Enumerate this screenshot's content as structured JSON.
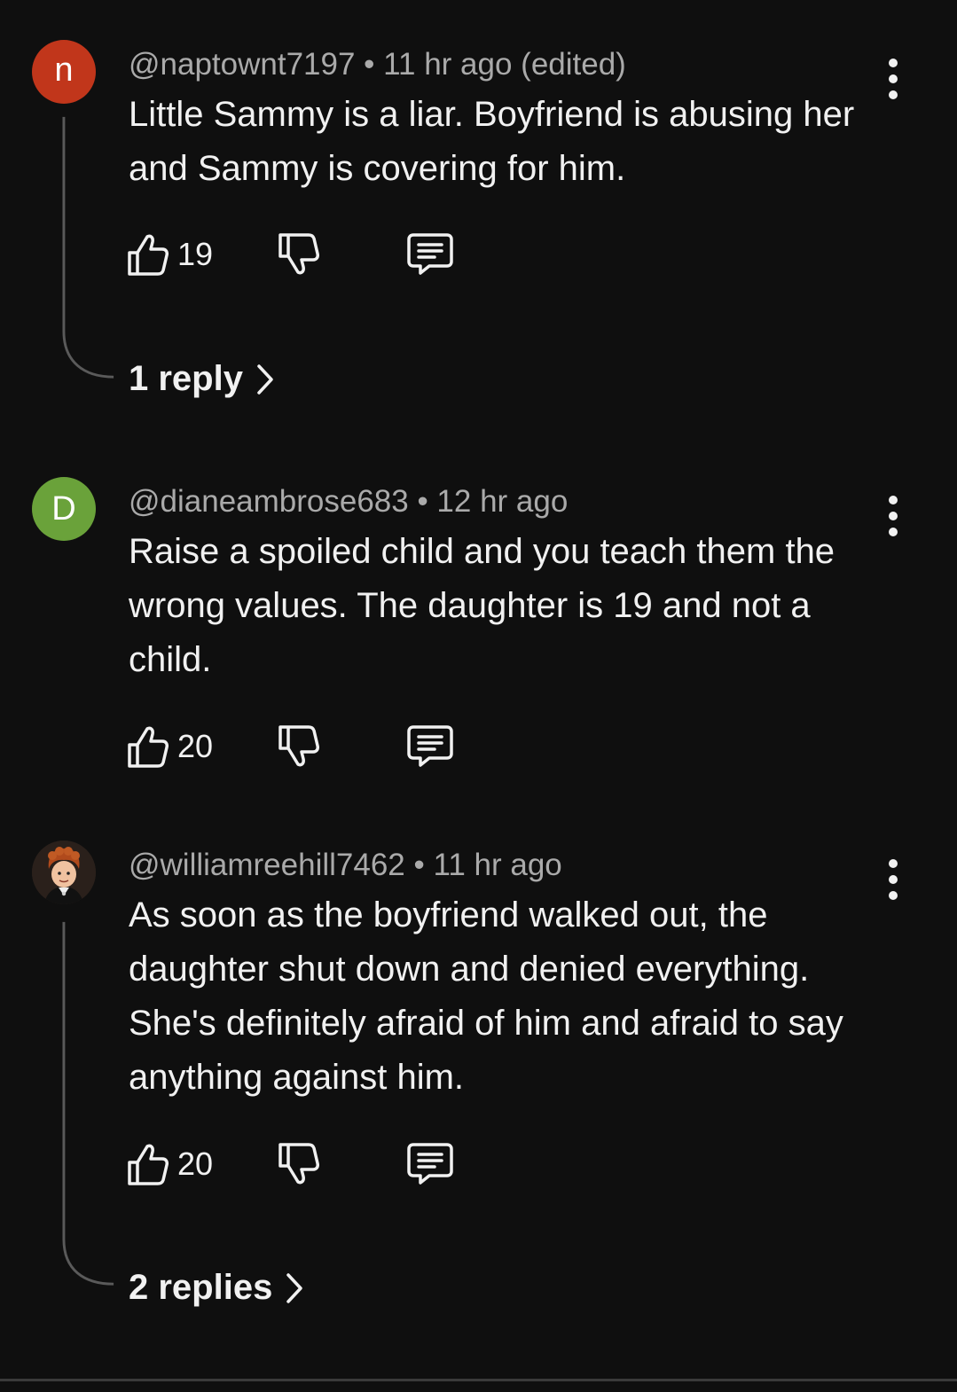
{
  "comments": [
    {
      "avatar_letter": "n",
      "avatar_color": "#c1361b",
      "meta": "@naptownt7197 • 11 hr ago (edited)",
      "text": "Little Sammy is a liar. Boyfriend is abusing her and Sammy is covering for him.",
      "likes": "19",
      "replies_label": "1 reply"
    },
    {
      "avatar_letter": "D",
      "avatar_color": "#6aa23a",
      "meta": "@dianeambrose683 • 12 hr ago",
      "text": "Raise a spoiled child and you teach them the wrong values.  The daughter is 19 and not a child.",
      "likes": "20"
    },
    {
      "avatar_letter": "",
      "avatar_color": "#3b2a22",
      "meta": "@williamreehill7462 • 11 hr ago",
      "text": "As soon as the boyfriend walked out, the daughter shut down and denied everything. She's definitely afraid of him and afraid to say anything against him.",
      "likes": "20",
      "replies_label": "2 replies"
    }
  ],
  "icons": {
    "like": "thumbs-up-icon",
    "dislike": "thumbs-down-icon",
    "reply": "comment-icon",
    "more": "more-vert-icon",
    "chevron": "chevron-right-icon"
  },
  "colors": {
    "background": "#0f0f0f",
    "text": "#f1f1f1",
    "meta": "#aaaaaa",
    "thread_line": "#5a5a5a"
  }
}
